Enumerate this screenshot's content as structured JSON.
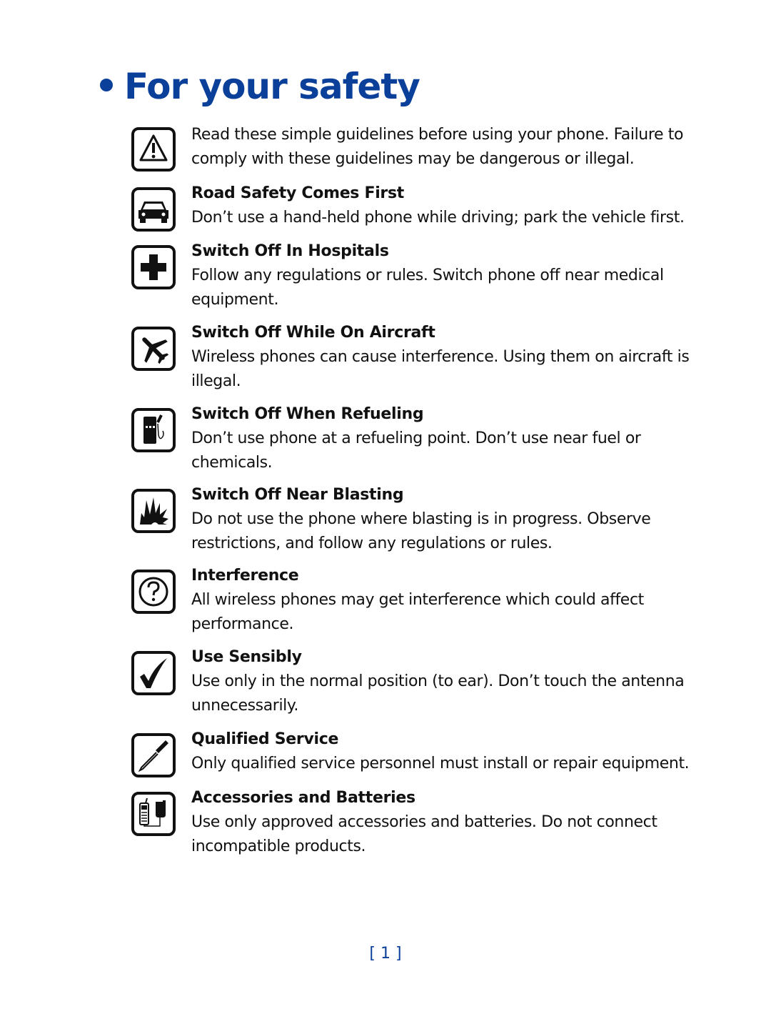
{
  "title": "For your safety",
  "intro": {
    "icon": "warning-icon",
    "text": "Read these simple guidelines before using your phone. Failure to comply with these guidelines may be dangerous or illegal."
  },
  "sections": [
    {
      "icon": "car-icon",
      "heading": "Road Safety Comes First",
      "text": "Don’t use a hand-held phone while driving; park the vehicle first."
    },
    {
      "icon": "hospital-cross-icon",
      "heading": "Switch Off In Hospitals",
      "text": "Follow any regulations or rules. Switch phone off near medical equipment."
    },
    {
      "icon": "airplane-icon",
      "heading": "Switch Off While On Aircraft",
      "text": "Wireless phones can cause interference. Using them on aircraft is illegal."
    },
    {
      "icon": "fuel-pump-icon",
      "heading": "Switch Off When Refueling",
      "text": "Don’t use phone at a refueling point. Don’t use near fuel or chemicals."
    },
    {
      "icon": "explosion-icon",
      "heading": "Switch Off Near Blasting",
      "text": "Do not use the phone where blasting is in progress. Observe restrictions, and follow any regulations or rules."
    },
    {
      "icon": "question-icon",
      "heading": "Interference",
      "text": "All wireless phones may get interference which could affect performance."
    },
    {
      "icon": "checkmark-icon",
      "heading": "Use Sensibly",
      "text": "Use only in the normal position (to ear). Don’t touch the antenna unnecessarily."
    },
    {
      "icon": "screwdriver-icon",
      "heading": "Qualified Service",
      "text": "Only qualified service personnel must install or repair equipment."
    },
    {
      "icon": "phone-charger-icon",
      "heading": "Accessories and Batteries",
      "text": "Use only approved accessories and batteries. Do not connect incompatible products."
    }
  ],
  "page_number": "[ 1 ]",
  "colors": {
    "accent": "#0a3f9a",
    "text": "#111111"
  }
}
